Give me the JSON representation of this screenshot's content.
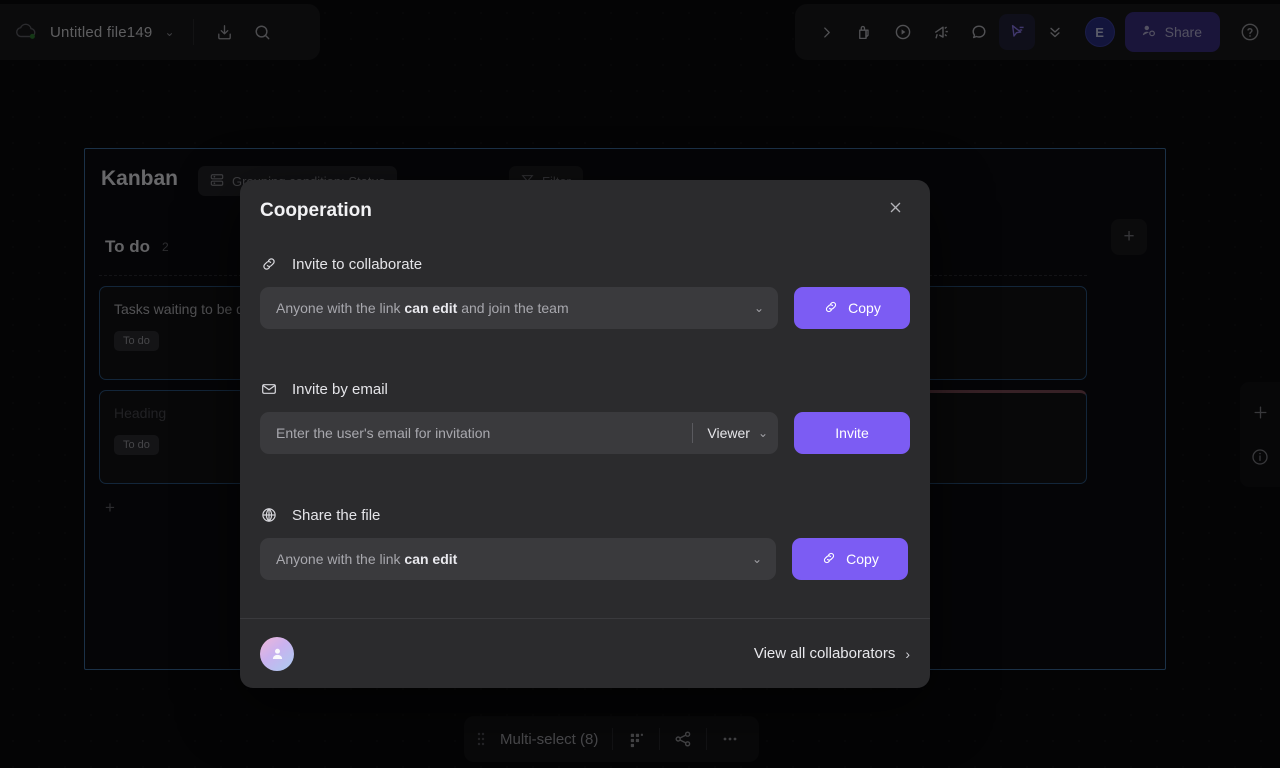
{
  "topbar": {
    "cloud_icon": "cloud-sync-icon",
    "file_name": "Untitled file149",
    "file_chevron": "⌄",
    "download_icon": "download-icon",
    "search_icon": "search-icon",
    "expand_icon": "chevron-right-icon",
    "lock_icon": "lock-page-icon",
    "play_icon": "play-circle-icon",
    "megaphone_icon": "announce-icon",
    "comment_icon": "comment-icon",
    "cursor_icon": "cursor-select-icon",
    "more_icon": "chevrons-down-icon",
    "avatar_initial": "E",
    "share_label": "Share",
    "share_icon": "share-user-icon",
    "help_icon": "help-circle-icon"
  },
  "board": {
    "title": "Kanban",
    "group_chip": "Grouping condition: Status",
    "group_chip_icon": "group-rows-icon",
    "second_chip": "Filter",
    "second_chip_icon": "filter-icon",
    "add_column_icon": "+",
    "columns": [
      {
        "name": "To do",
        "count": "2",
        "add_label": "+",
        "cards": [
          {
            "title": "Tasks waiting to be done",
            "tag": "To do",
            "dim": false,
            "pink": false
          },
          {
            "title": "Heading",
            "tag": "To do",
            "dim": true,
            "pink": false
          }
        ]
      },
      {
        "name": "",
        "count": "",
        "add_label": "",
        "cards": [
          {
            "title": "",
            "tag": "",
            "dim": true,
            "pink": false
          },
          {
            "title": "",
            "tag": "",
            "dim": true,
            "pink": true
          }
        ]
      }
    ]
  },
  "right_rail": {
    "add_icon": "plus-icon",
    "info_icon": "info-circle-icon"
  },
  "bottombar": {
    "grip_icon": "drag-grip-icon",
    "label": "Multi-select (8)",
    "grid_icon": "layout-grid-icon",
    "node_icon": "share-nodes-icon",
    "more_icon": "ellipsis-icon"
  },
  "modal": {
    "title": "Cooperation",
    "close_icon": "close-icon",
    "sections": {
      "invite_collab": {
        "icon": "link-icon",
        "heading": "Invite to collaborate",
        "value_prefix": "Anyone with the link ",
        "value_bold": "can edit",
        "value_suffix": " and join the team",
        "chevron": "⌄",
        "button_label": "Copy",
        "button_icon": "link-icon"
      },
      "invite_email": {
        "icon": "mail-icon",
        "heading": "Invite by email",
        "placeholder": "Enter the user's email for invitation",
        "input_value": "",
        "role": "Viewer",
        "role_chevron": "⌄",
        "button_label": "Invite"
      },
      "share_file": {
        "icon": "globe-icon",
        "heading": "Share the file",
        "value_prefix": "Anyone with the link ",
        "value_bold": "can edit",
        "value_suffix": "",
        "chevron": "⌄",
        "button_label": "Copy",
        "button_icon": "link-icon"
      }
    },
    "footer": {
      "avatar_icon": "user-avatar-icon",
      "view_all_label": "View all collaborators",
      "chevron": "›"
    }
  },
  "colors": {
    "accent_purple": "#7c5cf3",
    "modal_bg": "#2b2b2d",
    "field_bg": "#3a3a3d",
    "selection_blue": "#3d6e9e",
    "card_border_blue": "#2c5680",
    "card_border_pink": "#7a4a55",
    "page_bg": "#0b0b0d"
  }
}
